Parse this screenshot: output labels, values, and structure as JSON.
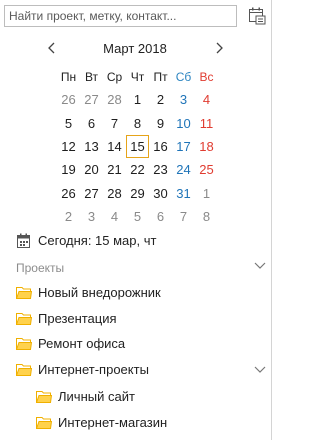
{
  "search": {
    "placeholder": "Найти проект, метку, контакт..."
  },
  "calendar": {
    "month_label": "Март 2018",
    "weekdays": [
      "Пн",
      "Вт",
      "Ср",
      "Чт",
      "Пт",
      "Сб",
      "Вс"
    ],
    "weeks": [
      [
        "26",
        "27",
        "28",
        "1",
        "2",
        "3",
        "4"
      ],
      [
        "5",
        "6",
        "7",
        "8",
        "9",
        "10",
        "11"
      ],
      [
        "12",
        "13",
        "14",
        "15",
        "16",
        "17",
        "18"
      ],
      [
        "19",
        "20",
        "21",
        "22",
        "23",
        "24",
        "25"
      ],
      [
        "26",
        "27",
        "28",
        "29",
        "30",
        "31",
        "1"
      ],
      [
        "2",
        "3",
        "4",
        "5",
        "6",
        "7",
        "8"
      ]
    ],
    "selected_day": "15"
  },
  "today": {
    "label": "Сегодня: 15 мар, чт"
  },
  "projects": {
    "section_title": "Проекты",
    "items": [
      {
        "label": "Новый внедорожник"
      },
      {
        "label": "Презентация"
      },
      {
        "label": "Ремонт офиса"
      },
      {
        "label": "Интернет-проекты"
      },
      {
        "label": "Личный сайт"
      },
      {
        "label": "Интернет-магазин"
      }
    ]
  },
  "colors": {
    "folder": "#f0b000",
    "today_outline": "#e6a41a",
    "saturday": "#1f74b8",
    "sunday": "#e03c31",
    "other_month": "#8a8a8a"
  }
}
